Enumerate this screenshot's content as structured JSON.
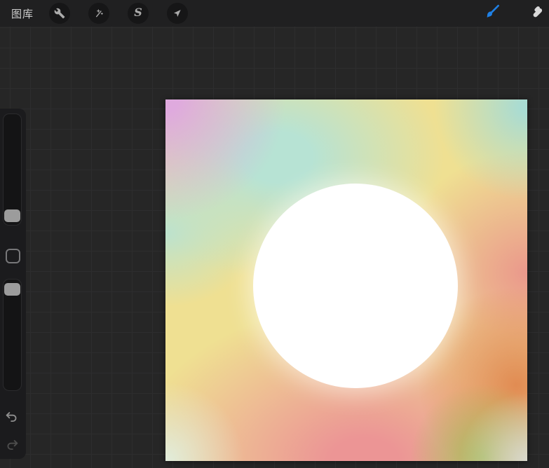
{
  "topbar": {
    "gallery_label": "图库",
    "left_tools": [
      {
        "id": "actions",
        "icon": "wrench-icon"
      },
      {
        "id": "adjustments",
        "icon": "magic-wand-icon"
      },
      {
        "id": "selection",
        "icon": "selection-s-icon",
        "glyph": "S"
      },
      {
        "id": "transform",
        "icon": "transform-arrow-icon"
      }
    ],
    "right_tools": [
      {
        "id": "paint",
        "icon": "brush-icon",
        "active": true,
        "accent_color": "#1f80e5"
      },
      {
        "id": "smudge",
        "icon": "smudge-finger-icon",
        "active": false,
        "color": "#d9d9d9"
      }
    ]
  },
  "sidebar": {
    "brush_size_slider": {
      "handle_position": "bottom"
    },
    "opacity_slider": {
      "handle_position": "top"
    },
    "modify_button": {
      "icon": "modify-square-icon"
    },
    "undo": {
      "icon": "undo-arrow-icon",
      "enabled": true
    },
    "redo": {
      "icon": "redo-arrow-icon",
      "enabled": false
    }
  },
  "canvas": {
    "content": "rainbow gradient background with centered white circle",
    "circle_color": "#ffffff",
    "gradient_colors": [
      "#dfaade",
      "#b7e3d4",
      "#efe092",
      "#ec9595",
      "#ea948b",
      "#e0884f",
      "#a3bb58",
      "#d8d8cd"
    ]
  },
  "colors": {
    "workspace_background": "#262626",
    "grid_line": "#2d2d2e",
    "topbar_background": "#202021",
    "tool_icon": "#ababab",
    "sidebar_background": "#1b1b1d",
    "slider_handle": "#9c9c9c"
  }
}
